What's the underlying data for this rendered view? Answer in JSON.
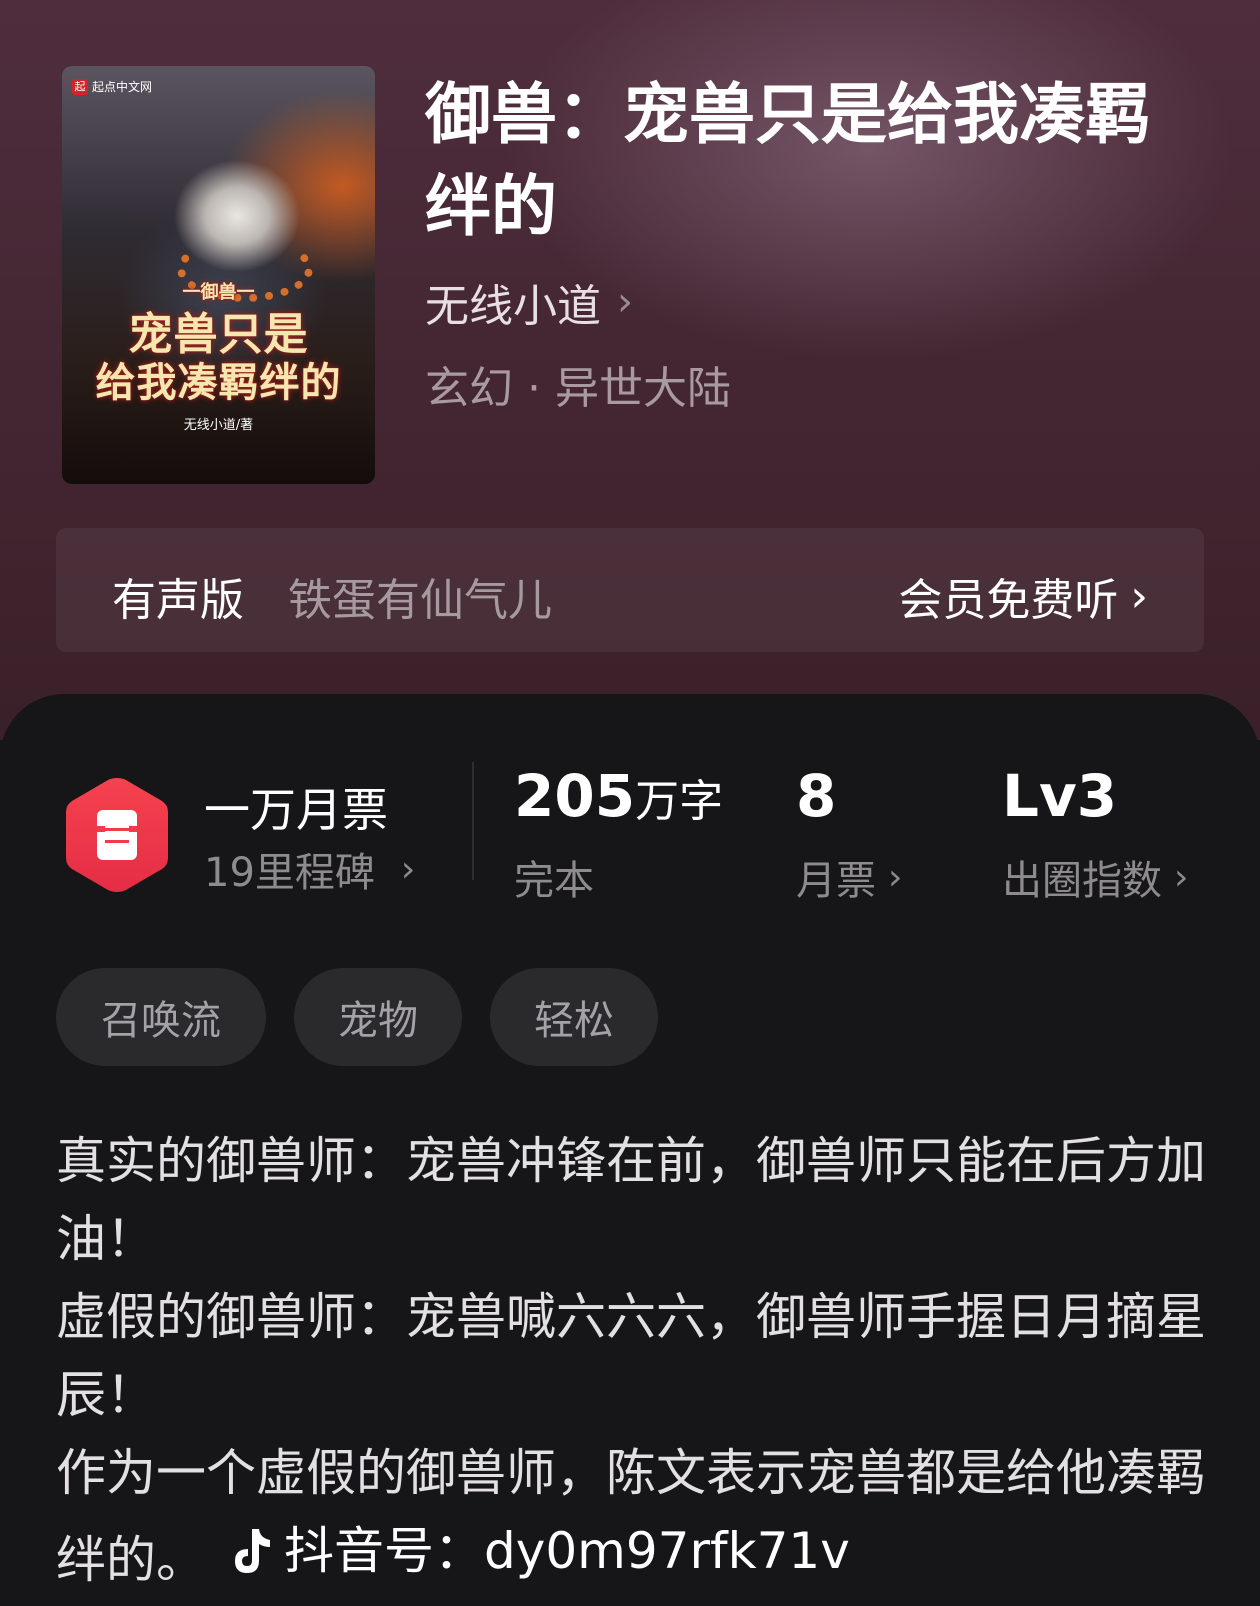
{
  "cover": {
    "platform_logo_text": "起点中文网",
    "title_small": "一御兽一",
    "title_line1": "宠兽只是",
    "title_line2": "给我凑羁绊的",
    "author_text": "无线小道/著"
  },
  "book": {
    "title": "御兽：宠兽只是给我凑羁绊的",
    "author": "无线小道",
    "genre": "玄幻 · 异世大陆"
  },
  "audio": {
    "label": "有声版",
    "narrator": "铁蛋有仙气儿",
    "cta": "会员免费听"
  },
  "stats": {
    "milestone_title": "一万月票",
    "milestone_sub": "19里程碑",
    "word_count": "205",
    "word_unit": "万字",
    "status": "完本",
    "monthly_votes": "8",
    "monthly_votes_label": "月票",
    "level": "Lv3",
    "level_label": "出圈指数"
  },
  "tags": [
    "召唤流",
    "宠物",
    "轻松"
  ],
  "description": {
    "p1": "真实的御兽师：宠兽冲锋在前，御兽师只能在后方加油！",
    "p2": "虚假的御兽师：宠兽喊六六六，御兽师手握日月摘星辰！",
    "p3": "作为一个虚假的御兽师，陈文表示宠兽都是给他凑羁绊的。",
    "watermark": "抖音号：dy0m97rfk71v"
  },
  "colors": {
    "hero_bg": "#4a2a38",
    "panel_bg": "#161517",
    "badge_red": "#f0334a"
  },
  "icons": {
    "chevron": "chevron-right-icon",
    "badge": "ticket-hexagon-icon",
    "watermark": "tiktok-icon"
  }
}
